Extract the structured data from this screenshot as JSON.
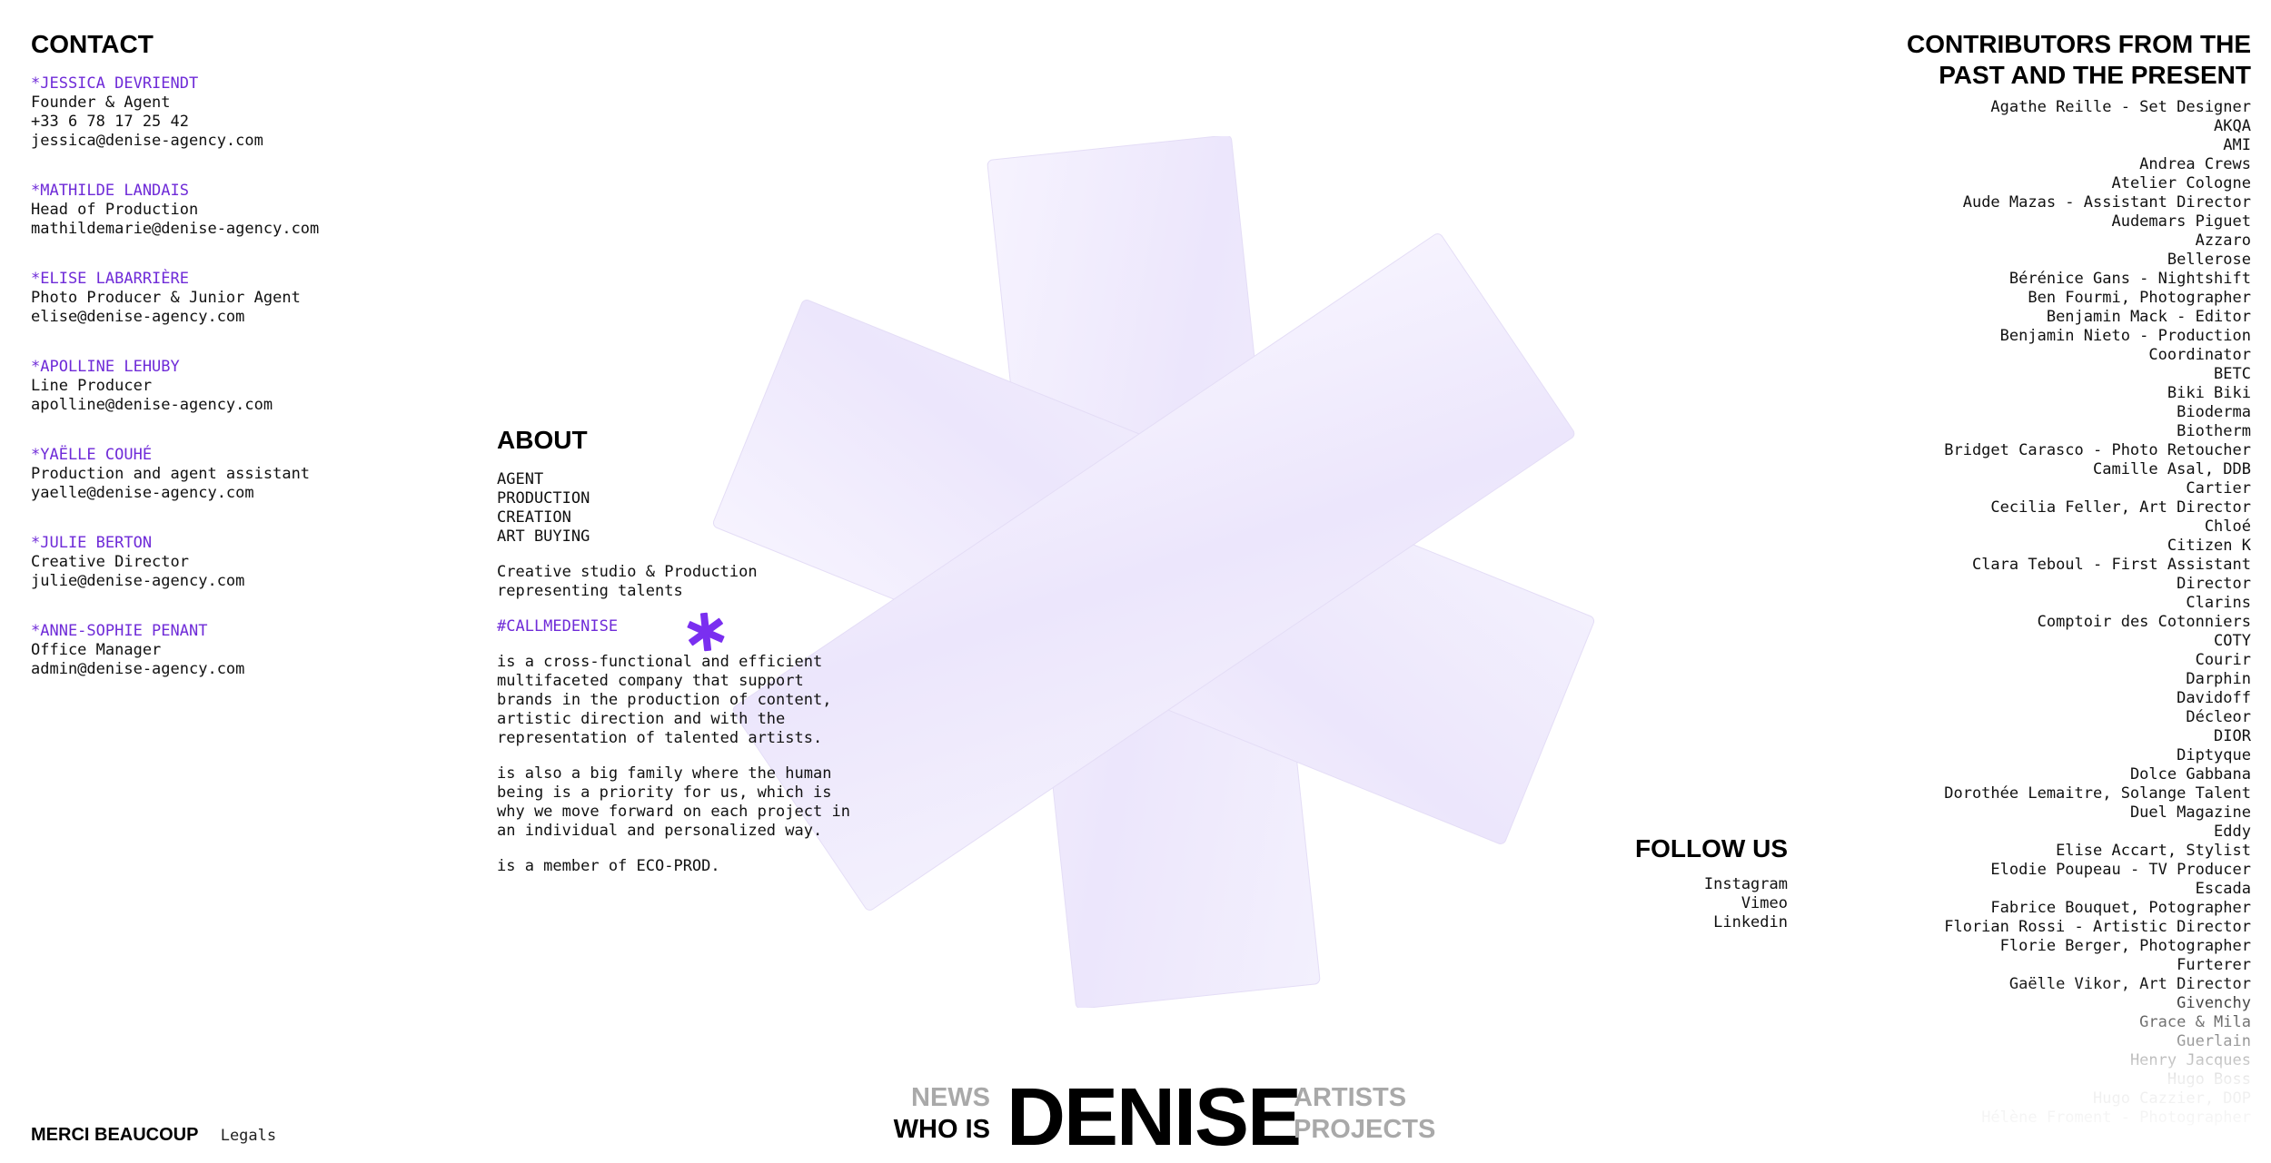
{
  "theme": {
    "accent": "#6f2bd8",
    "nav_inactive": "#a9a9a9",
    "star_tint": "#efeafc"
  },
  "contact": {
    "heading": "CONTACT",
    "people": [
      {
        "name": "*JESSICA DEVRIENDT",
        "role": "Founder & Agent",
        "phone": "+33 6 78 17 25 42",
        "email": "jessica@denise-agency.com"
      },
      {
        "name": "*MATHILDE LANDAIS",
        "role": "Head of Production",
        "email": "mathildemarie@denise-agency.com"
      },
      {
        "name": "*ELISE LABARRIÈRE",
        "role": "Photo Producer & Junior Agent",
        "email": "elise@denise-agency.com"
      },
      {
        "name": "*APOLLINE LEHUBY",
        "role": "Line Producer",
        "email": "apolline@denise-agency.com"
      },
      {
        "name": "*YAËLLE COUHÉ",
        "role": "Production and agent assistant",
        "email": "yaelle@denise-agency.com"
      },
      {
        "name": "*JULIE BERTON",
        "role": "Creative Director",
        "email": "julie@denise-agency.com"
      },
      {
        "name": "*ANNE-SOPHIE PENANT",
        "role": "Office Manager",
        "email": "admin@denise-agency.com"
      }
    ]
  },
  "about": {
    "heading": "ABOUT",
    "services": [
      "AGENT",
      "PRODUCTION",
      "CREATION",
      "ART BUYING"
    ],
    "tagline": [
      "Creative studio & Production",
      "representing talents"
    ],
    "hashtag": "#CALLMEDENISE",
    "paragraphs": [
      [
        "is a cross-functional and efficient",
        "multifaceted company that support",
        "brands in the production of content,",
        "artistic direction and with the",
        "representation of talented artists."
      ],
      [
        "is also a big family where the human",
        "being is a priority for us, which is",
        "why we move forward on each project in",
        "an individual and personalized way."
      ],
      [
        "is a member of ECO-PROD."
      ]
    ]
  },
  "follow": {
    "heading": "FOLLOW US",
    "links": [
      "Instagram",
      "Vimeo",
      "Linkedin"
    ]
  },
  "contributors": {
    "heading_line1": "CONTRIBUTORS FROM THE",
    "heading_line2": "PAST AND THE PRESENT",
    "items": [
      "Agathe Reille - Set Designer",
      "AKQA",
      "AMI",
      "Andrea Crews",
      "Atelier Cologne",
      "Aude Mazas - Assistant Director",
      "Audemars Piguet",
      "Azzaro",
      "Bellerose",
      "Bérénice Gans - Nightshift",
      "Ben Fourmi, Photographer",
      "Benjamin Mack - Editor",
      "Benjamin Nieto - Production",
      "Coordinator",
      "BETC",
      "Biki Biki",
      "Bioderma",
      "Biotherm",
      "Bridget Carasco - Photo Retoucher",
      "Camille Asal, DDB",
      "Cartier",
      "Cecilia Feller, Art Director",
      "Chloé",
      "Citizen K",
      "Clara Teboul - First Assistant",
      "Director",
      "Clarins",
      "Comptoir des Cotonniers",
      "COTY",
      "Courir",
      "Darphin",
      "Davidoff",
      "Décleor",
      "DIOR",
      "Diptyque",
      "Dolce Gabbana",
      "Dorothée Lemaitre, Solange Talent",
      "Duel Magazine",
      "Eddy",
      "Elise Accart, Stylist",
      "Elodie Poupeau - TV Producer",
      "Escada",
      "Fabrice Bouquet, Potographer",
      "Florian Rossi - Artistic Director",
      "Florie Berger, Photographer",
      "Furterer",
      "Gaëlle Vikor, Art Director",
      "Givenchy",
      "Grace & Mila",
      "Guerlain",
      "Henry Jacques",
      "Hugo Boss",
      "Hugo Cazzier, DOP",
      "Hélène Froment - Photographer"
    ]
  },
  "nav": {
    "news": "NEWS",
    "who_is": "WHO IS",
    "logo": "DENISE",
    "artists": "ARTISTS",
    "projects": "PROJECTS"
  },
  "footer": {
    "thanks": "MERCI BEAUCOUP",
    "legals": "Legals"
  }
}
